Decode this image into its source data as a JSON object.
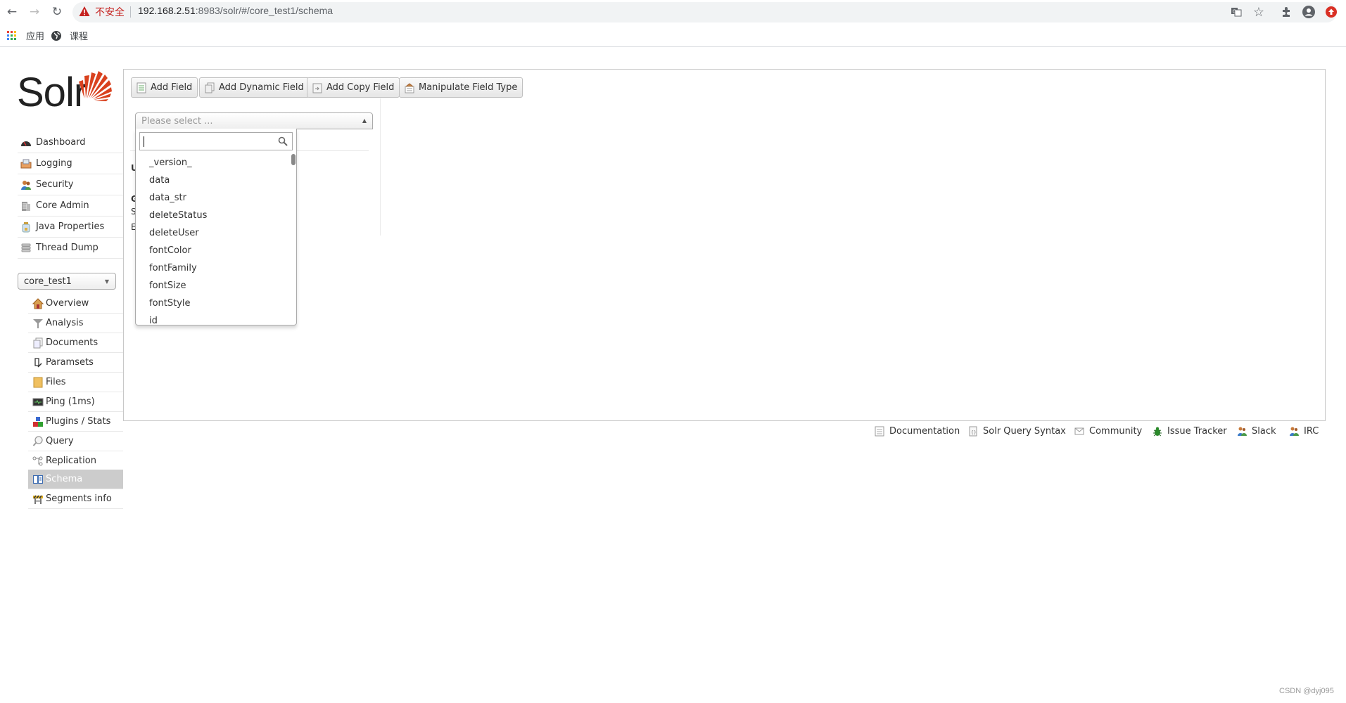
{
  "browser": {
    "security_label": "不安全",
    "url_host": "192.168.2.51",
    "url_rest": ":8983/solr/#/core_test1/schema",
    "bookmarks": [
      {
        "icon": "apps-grid-icon",
        "label": "应用"
      },
      {
        "icon": "globe-icon",
        "label": "课程"
      }
    ]
  },
  "logo": {
    "text": "Solr"
  },
  "sidebar": {
    "main_nav": [
      {
        "icon": "dashboard-icon",
        "label": "Dashboard"
      },
      {
        "icon": "logging-icon",
        "label": "Logging"
      },
      {
        "icon": "security-icon",
        "label": "Security"
      },
      {
        "icon": "core-admin-icon",
        "label": "Core Admin"
      },
      {
        "icon": "java-properties-icon",
        "label": "Java Properties"
      },
      {
        "icon": "thread-dump-icon",
        "label": "Thread Dump"
      }
    ],
    "core_selector": {
      "value": "core_test1"
    },
    "core_menu": [
      {
        "icon": "home-icon",
        "label": "Overview",
        "active": false
      },
      {
        "icon": "funnel-icon",
        "label": "Analysis",
        "active": false
      },
      {
        "icon": "documents-icon",
        "label": "Documents",
        "active": false
      },
      {
        "icon": "paramsets-icon",
        "label": "Paramsets",
        "active": false
      },
      {
        "icon": "folder-icon",
        "label": "Files",
        "active": false
      },
      {
        "icon": "ping-icon",
        "label": "Ping (1ms)",
        "active": false
      },
      {
        "icon": "plugins-icon",
        "label": "Plugins / Stats",
        "active": false
      },
      {
        "icon": "magnifier-icon",
        "label": "Query",
        "active": false
      },
      {
        "icon": "replication-icon",
        "label": "Replication",
        "active": false
      },
      {
        "icon": "book-icon",
        "label": "Schema",
        "active": true
      },
      {
        "icon": "segments-icon",
        "label": "Segments info",
        "active": false
      }
    ]
  },
  "toolbar": {
    "buttons": [
      {
        "icon": "document-icon",
        "label": "Add Field"
      },
      {
        "icon": "documents-icon",
        "label": "Add Dynamic Field"
      },
      {
        "icon": "copy-field-icon",
        "label": "Add Copy Field"
      },
      {
        "icon": "field-type-icon",
        "label": "Manipulate Field Type"
      }
    ]
  },
  "field_select": {
    "placeholder": "Please select ...",
    "search_value": "",
    "options": [
      "_version_",
      "data",
      "data_str",
      "deleteStatus",
      "deleteUser",
      "fontColor",
      "fontFamily",
      "fontSize",
      "fontStyle",
      "id"
    ]
  },
  "obscured_letters": [
    "U",
    "G",
    "S",
    "E"
  ],
  "footer": {
    "links": [
      {
        "icon": "documentation-icon",
        "label": "Documentation"
      },
      {
        "icon": "query-syntax-icon",
        "label": "Solr Query Syntax"
      },
      {
        "icon": "mail-icon",
        "label": "Community"
      },
      {
        "icon": "bug-icon",
        "label": "Issue Tracker"
      },
      {
        "icon": "people-icon",
        "label": "Slack"
      },
      {
        "icon": "people-icon",
        "label": "IRC"
      }
    ]
  },
  "watermark": "CSDN @dyj095",
  "colors": {
    "logo_red": "#d9411e",
    "active_nav_bg": "#cccccc",
    "insecure_red": "#c5221f"
  }
}
